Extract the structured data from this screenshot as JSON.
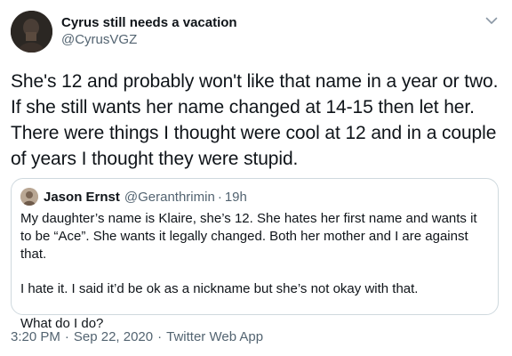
{
  "author": {
    "display_name": "Cyrus still needs a vacation",
    "handle": "@CyrusVGZ",
    "avatar_icon": "profile-photo"
  },
  "tweet": {
    "text": "She's 12 and probably won't like that name in a year or two. If she still wants her name changed at 14-15 then let her. There were things I thought were cool at 12 and in a couple of years I thought they were stupid."
  },
  "quoted": {
    "display_name": "Jason Ernst",
    "handle": "@Geranthrimin",
    "separator": "·",
    "time": "19h",
    "paragraphs": [
      "My daughter’s name is Klaire, she’s 12. She hates her first name and wants it to be “Ace”. She wants it legally changed. Both her mother and I are against that.",
      "I hate it. I said it’d be ok as a nickname but she’s not okay with that.",
      "What do I do?"
    ]
  },
  "meta": {
    "time": "3:20 PM",
    "date": "Sep 22, 2020",
    "separator": "·",
    "source": "Twitter Web App"
  },
  "colors": {
    "text_primary": "#0f1419",
    "text_secondary": "#536471",
    "border": "#cfd9de"
  },
  "icons": {
    "menu": "chevron-down-icon"
  }
}
